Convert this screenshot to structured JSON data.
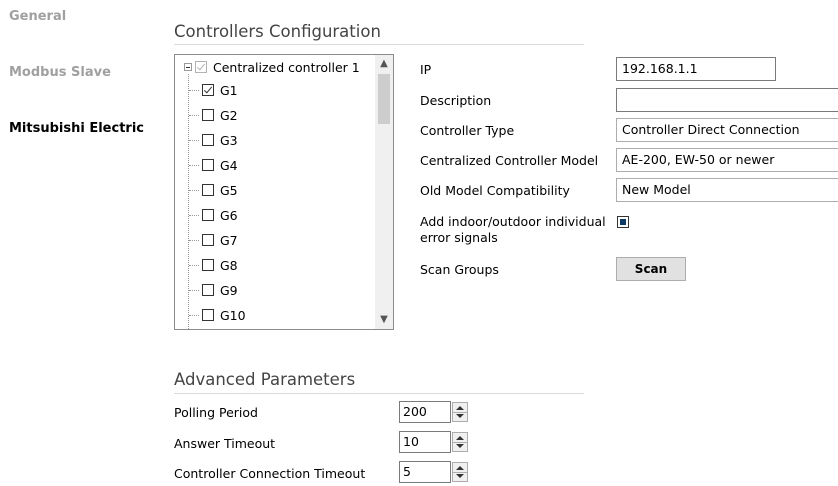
{
  "nav": {
    "general": "General",
    "modbus_slave": "Modbus Slave",
    "mitsubishi": "Mitsubishi Electric"
  },
  "controllers": {
    "title": "Controllers Configuration",
    "root_label": "Centralized controller 1",
    "groups": [
      {
        "label": "G1",
        "checked": true
      },
      {
        "label": "G2",
        "checked": false
      },
      {
        "label": "G3",
        "checked": false
      },
      {
        "label": "G4",
        "checked": false
      },
      {
        "label": "G5",
        "checked": false
      },
      {
        "label": "G6",
        "checked": false
      },
      {
        "label": "G7",
        "checked": false
      },
      {
        "label": "G8",
        "checked": false
      },
      {
        "label": "G9",
        "checked": false
      },
      {
        "label": "G10",
        "checked": false
      }
    ]
  },
  "form": {
    "ip_label": "IP",
    "ip_value": "192.168.1.1",
    "description_label": "Description",
    "description_value": "",
    "controller_type_label": "Controller Type",
    "controller_type_value": "Controller Direct Connection",
    "cc_model_label": "Centralized Controller Model",
    "cc_model_value": "AE-200, EW-50 or newer",
    "old_model_label": "Old Model Compatibility",
    "old_model_value": "New Model",
    "add_signals_label_1": "Add indoor/outdoor individual",
    "add_signals_label_2": "error signals",
    "add_signals_checked": true,
    "scan_groups_label": "Scan Groups",
    "scan_button": "Scan"
  },
  "advanced": {
    "title": "Advanced Parameters",
    "polling_label": "Polling Period",
    "polling_value": "200",
    "answer_timeout_label": "Answer Timeout",
    "answer_timeout_value": "10",
    "conn_timeout_label": "Controller Connection Timeout",
    "conn_timeout_value": "5"
  },
  "icons": {
    "scroll_up": "▲",
    "scroll_down": "▼",
    "dropdown": "⌄"
  }
}
